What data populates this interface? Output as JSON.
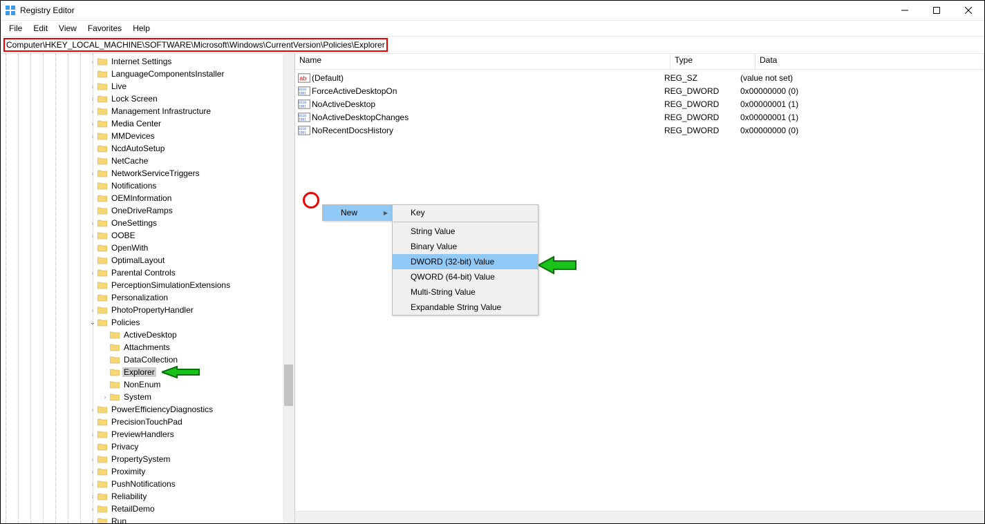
{
  "title": "Registry Editor",
  "menubar": [
    "File",
    "Edit",
    "View",
    "Favorites",
    "Help"
  ],
  "address": "Computer\\HKEY_LOCAL_MACHINE\\SOFTWARE\\Microsoft\\Windows\\CurrentVersion\\Policies\\Explorer",
  "list": {
    "cols": {
      "name": "Name",
      "type": "Type",
      "data": "Data"
    },
    "rows": [
      {
        "icon": "ab",
        "name": "(Default)",
        "type": "REG_SZ",
        "data": "(value not set)"
      },
      {
        "icon": "bin",
        "name": "ForceActiveDesktopOn",
        "type": "REG_DWORD",
        "data": "0x00000000 (0)"
      },
      {
        "icon": "bin",
        "name": "NoActiveDesktop",
        "type": "REG_DWORD",
        "data": "0x00000001 (1)"
      },
      {
        "icon": "bin",
        "name": "NoActiveDesktopChanges",
        "type": "REG_DWORD",
        "data": "0x00000001 (1)"
      },
      {
        "icon": "bin",
        "name": "NoRecentDocsHistory",
        "type": "REG_DWORD",
        "data": "0x00000000 (0)"
      }
    ]
  },
  "ctx1": "New",
  "ctx2": [
    "Key",
    "-",
    "String Value",
    "Binary Value",
    "DWORD (32-bit) Value",
    "QWORD (64-bit) Value",
    "Multi-String Value",
    "Expandable String Value"
  ],
  "ctx2_highlight": 4,
  "tree": [
    {
      "indent": 7,
      "chev": ">",
      "label": "Internet Settings"
    },
    {
      "indent": 7,
      "chev": "",
      "label": "LanguageComponentsInstaller"
    },
    {
      "indent": 7,
      "chev": ">",
      "label": "Live"
    },
    {
      "indent": 7,
      "chev": ">",
      "label": "Lock Screen"
    },
    {
      "indent": 7,
      "chev": ">",
      "label": "Management Infrastructure"
    },
    {
      "indent": 7,
      "chev": ">",
      "label": "Media Center"
    },
    {
      "indent": 7,
      "chev": ">",
      "label": "MMDevices"
    },
    {
      "indent": 7,
      "chev": "",
      "label": "NcdAutoSetup"
    },
    {
      "indent": 7,
      "chev": "",
      "label": "NetCache"
    },
    {
      "indent": 7,
      "chev": ">",
      "label": "NetworkServiceTriggers"
    },
    {
      "indent": 7,
      "chev": "",
      "label": "Notifications"
    },
    {
      "indent": 7,
      "chev": "",
      "label": "OEMInformation"
    },
    {
      "indent": 7,
      "chev": "",
      "label": "OneDriveRamps"
    },
    {
      "indent": 7,
      "chev": ">",
      "label": "OneSettings"
    },
    {
      "indent": 7,
      "chev": ">",
      "label": "OOBE"
    },
    {
      "indent": 7,
      "chev": "",
      "label": "OpenWith"
    },
    {
      "indent": 7,
      "chev": "",
      "label": "OptimalLayout"
    },
    {
      "indent": 7,
      "chev": ">",
      "label": "Parental Controls"
    },
    {
      "indent": 7,
      "chev": "",
      "label": "PerceptionSimulationExtensions"
    },
    {
      "indent": 7,
      "chev": "",
      "label": "Personalization"
    },
    {
      "indent": 7,
      "chev": ">",
      "label": "PhotoPropertyHandler"
    },
    {
      "indent": 7,
      "chev": "v",
      "label": "Policies"
    },
    {
      "indent": 8,
      "chev": "",
      "label": "ActiveDesktop"
    },
    {
      "indent": 8,
      "chev": "",
      "label": "Attachments"
    },
    {
      "indent": 8,
      "chev": "",
      "label": "DataCollection"
    },
    {
      "indent": 8,
      "chev": "",
      "label": "Explorer",
      "sel": true,
      "arrow": true
    },
    {
      "indent": 8,
      "chev": "",
      "label": "NonEnum"
    },
    {
      "indent": 8,
      "chev": ">",
      "label": "System"
    },
    {
      "indent": 7,
      "chev": ">",
      "label": "PowerEfficiencyDiagnostics"
    },
    {
      "indent": 7,
      "chev": "",
      "label": "PrecisionTouchPad"
    },
    {
      "indent": 7,
      "chev": ">",
      "label": "PreviewHandlers"
    },
    {
      "indent": 7,
      "chev": "",
      "label": "Privacy"
    },
    {
      "indent": 7,
      "chev": ">",
      "label": "PropertySystem"
    },
    {
      "indent": 7,
      "chev": ">",
      "label": "Proximity"
    },
    {
      "indent": 7,
      "chev": ">",
      "label": "PushNotifications"
    },
    {
      "indent": 7,
      "chev": ">",
      "label": "Reliability"
    },
    {
      "indent": 7,
      "chev": ">",
      "label": "RetailDemo"
    },
    {
      "indent": 7,
      "chev": ">",
      "label": "Run"
    }
  ]
}
